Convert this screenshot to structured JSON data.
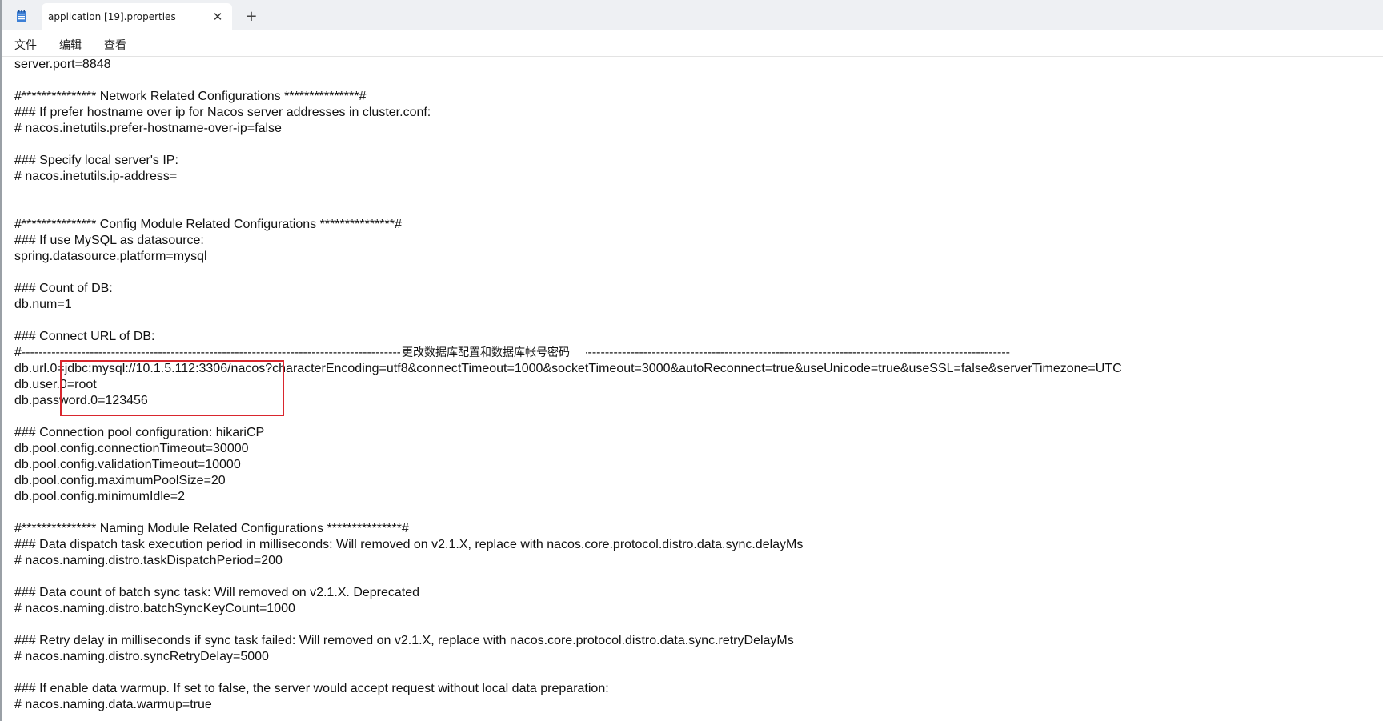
{
  "tab": {
    "title": "application [19].properties",
    "close_glyph": "✕",
    "new_tab_glyph": "+"
  },
  "menu": [
    "文件",
    "编辑",
    "查看"
  ],
  "lines": [
    {
      "row": 0,
      "text": "server.port=8848"
    },
    {
      "row": 2,
      "text": "#*************** Network Related Configurations ***************#"
    },
    {
      "row": 3,
      "text": "### If prefer hostname over ip for Nacos server addresses in cluster.conf:"
    },
    {
      "row": 4,
      "text": "# nacos.inetutils.prefer-hostname-over-ip=false"
    },
    {
      "row": 6,
      "text": "### Specify local server's IP:"
    },
    {
      "row": 7,
      "text": "# nacos.inetutils.ip-address="
    },
    {
      "row": 10,
      "text": "#*************** Config Module Related Configurations ***************#"
    },
    {
      "row": 11,
      "text": "### If use MySQL as datasource:"
    },
    {
      "row": 12,
      "text": "spring.datasource.platform=mysql"
    },
    {
      "row": 14,
      "text": "### Count of DB:"
    },
    {
      "row": 15,
      "text": "db.num=1"
    },
    {
      "row": 17,
      "text": "### Connect URL of DB:"
    },
    {
      "row": 19,
      "text": "db.url.0=jdbc:mysql://10.1.5.112:3306/nacos?characterEncoding=utf8&connectTimeout=1000&socketTimeout=3000&autoReconnect=true&useUnicode=true&useSSL=false&serverTimezone=UTC"
    },
    {
      "row": 20,
      "text": "db.user.0=root"
    },
    {
      "row": 21,
      "text": "db.password.0=123456"
    },
    {
      "row": 23,
      "text": "### Connection pool configuration: hikariCP"
    },
    {
      "row": 24,
      "text": "db.pool.config.connectionTimeout=30000"
    },
    {
      "row": 25,
      "text": "db.pool.config.validationTimeout=10000"
    },
    {
      "row": 26,
      "text": "db.pool.config.maximumPoolSize=20"
    },
    {
      "row": 27,
      "text": "db.pool.config.minimumIdle=2"
    },
    {
      "row": 29,
      "text": "#*************** Naming Module Related Configurations ***************#"
    },
    {
      "row": 30,
      "text": "### Data dispatch task execution period in milliseconds: Will removed on v2.1.X, replace with nacos.core.protocol.distro.data.sync.delayMs"
    },
    {
      "row": 31,
      "text": "# nacos.naming.distro.taskDispatchPeriod=200"
    },
    {
      "row": 33,
      "text": "### Data count of batch sync task: Will removed on v2.1.X. Deprecated"
    },
    {
      "row": 34,
      "text": "# nacos.naming.distro.batchSyncKeyCount=1000"
    },
    {
      "row": 36,
      "text": "### Retry delay in milliseconds if sync task failed: Will removed on v2.1.X, replace with nacos.core.protocol.distro.data.sync.retryDelayMs"
    },
    {
      "row": 37,
      "text": "# nacos.naming.distro.syncRetryDelay=5000"
    },
    {
      "row": 39,
      "text": "### If enable data warmup. If set to false, the server would accept request without local data preparation:"
    },
    {
      "row": 40,
      "text": "# nacos.naming.data.warmup=true"
    }
  ],
  "separator": {
    "row": 18,
    "left": "#------------------------------------------------------------------------------------------------------------------------------------------",
    "annotation": "更改数据库配置和数据库帐号密码",
    "right": "------------------------------------------------------------------------------------------------------------------------------------------------------#"
  }
}
